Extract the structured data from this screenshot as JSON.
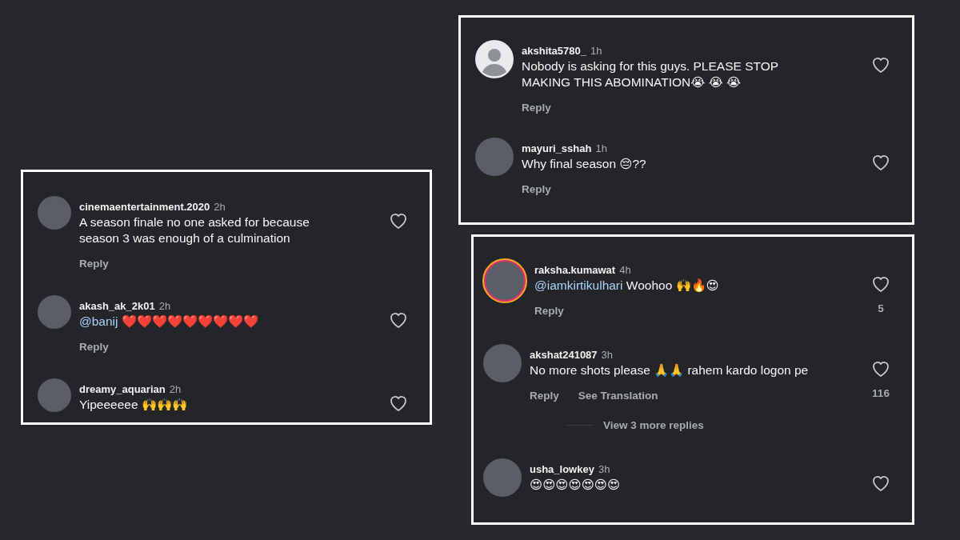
{
  "panels": [
    {
      "comments": [
        {
          "kind": "photo",
          "story_ring": false,
          "username": "cinemaentertainment.2020",
          "time": "2h",
          "text": "A season finale no one asked for because season 3 was enough of a culmination",
          "actions": [
            "Reply"
          ]
        },
        {
          "kind": "photo",
          "story_ring": false,
          "username": "akash_ak_2k01",
          "time": "2h",
          "mention": "@banij",
          "text": "❤️❤️❤️❤️❤️❤️❤️❤️❤️",
          "actions": [
            "Reply"
          ]
        },
        {
          "kind": "photo",
          "story_ring": false,
          "username": "dreamy_aquarian",
          "time": "2h",
          "text": "Yipeeeeee 🙌🙌🙌"
        }
      ]
    },
    {
      "comments": [
        {
          "kind": "default",
          "story_ring": false,
          "username": "akshita5780_",
          "time": "1h",
          "text": "Nobody is asking for this guys. PLEASE STOP MAKING THIS ABOMINATION😭 😭 😭",
          "actions": [
            "Reply"
          ]
        },
        {
          "kind": "photo",
          "story_ring": false,
          "username": "mayuri_sshah",
          "time": "1h",
          "text": "Why final season 😔??",
          "actions": [
            "Reply"
          ]
        }
      ]
    },
    {
      "comments": [
        {
          "kind": "photo",
          "story_ring": true,
          "username": "raksha.kumawat",
          "time": "4h",
          "mention": "@iamkirtikulhari",
          "text": "Woohoo 🙌🔥😍",
          "actions": [
            "Reply"
          ],
          "likes": "5"
        },
        {
          "kind": "photo",
          "story_ring": false,
          "username": "akshat241087",
          "time": "3h",
          "text": "No more shots please 🙏🙏 rahem kardo logon pe",
          "actions": [
            "Reply",
            "See Translation"
          ],
          "likes": "116",
          "view_replies": "View 3 more replies"
        },
        {
          "kind": "photo",
          "story_ring": false,
          "username": "usha_lowkey",
          "time": "3h",
          "text": "😍😍😍😍😍😍😍"
        }
      ]
    }
  ]
}
